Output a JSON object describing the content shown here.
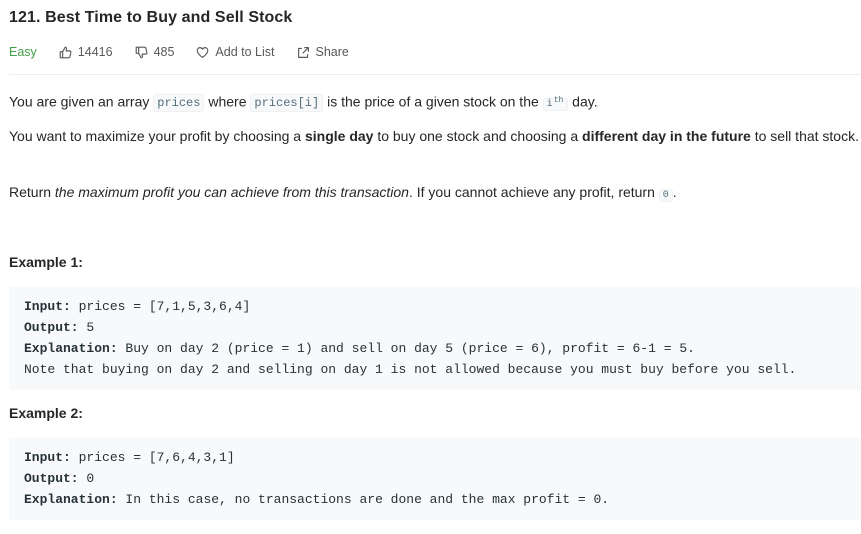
{
  "problem": {
    "title": "121. Best Time to Buy and Sell Stock",
    "difficulty": "Easy",
    "likes": "14416",
    "dislikes": "485",
    "add_to_list": "Add to List",
    "share": "Share"
  },
  "colors": {
    "easy": "#43a047",
    "code_bg": "#f7f9fa"
  },
  "icons": {
    "like": "thumbs-up-icon",
    "dislike": "thumbs-down-icon",
    "add": "heart-icon",
    "share": "share-icon"
  },
  "desc": {
    "p1": {
      "t1": "You are given an array ",
      "c1": "prices",
      "t2": " where ",
      "c2": "prices[i]",
      "t3": " is the price of a given stock on the ",
      "c3": "i",
      "sup": "th",
      "t4": " day."
    },
    "p2": {
      "t1": "You want to maximize your profit by choosing a ",
      "b1": "single day",
      "t2": " to buy one stock and choosing a ",
      "b2": "different day in the future",
      "t3": " to sell that stock."
    },
    "p3": {
      "t1": "Return ",
      "i1": "the maximum profit you can achieve from this transaction",
      "t2": ". If you cannot achieve any profit, return ",
      "c1": "0",
      "t3": "."
    }
  },
  "examples": [
    {
      "title": "Example 1:",
      "input_label": "Input:",
      "input": " prices = [7,1,5,3,6,4]",
      "output_label": "Output:",
      "output": " 5",
      "explanation_label": "Explanation:",
      "explanation": " Buy on day 2 (price = 1) and sell on day 5 (price = 6), profit = 6-1 = 5.",
      "note": "Note that buying on day 2 and selling on day 1 is not allowed because you must buy before you sell."
    },
    {
      "title": "Example 2:",
      "input_label": "Input:",
      "input": " prices = [7,6,4,3,1]",
      "output_label": "Output:",
      "output": " 0",
      "explanation_label": "Explanation:",
      "explanation": " In this case, no transactions are done and the max profit = 0."
    }
  ]
}
